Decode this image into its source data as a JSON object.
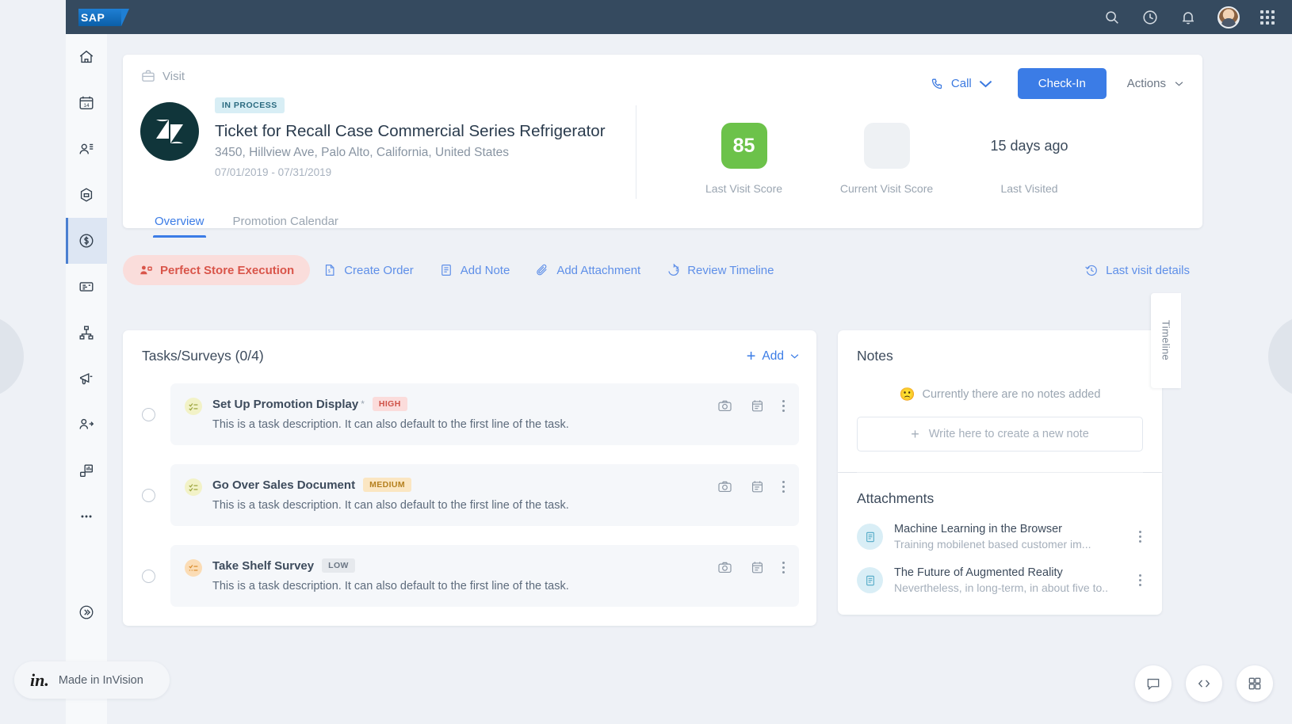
{
  "topbar": {
    "logo_text": "SAP",
    "icons": [
      "search-icon",
      "history-icon",
      "bell-icon",
      "avatar",
      "app-grid-icon"
    ]
  },
  "sidebar": {
    "items": [
      {
        "name": "home",
        "icon": "home-icon",
        "active": false
      },
      {
        "name": "calendar",
        "icon": "calendar-14-icon",
        "active": false
      },
      {
        "name": "contacts",
        "icon": "person-list-icon",
        "active": false
      },
      {
        "name": "products",
        "icon": "hexagon-icon",
        "active": false
      },
      {
        "name": "sales",
        "icon": "dollar-coin-icon",
        "active": true
      },
      {
        "name": "orders",
        "icon": "list-card-icon",
        "active": false
      },
      {
        "name": "hierarchy",
        "icon": "org-tree-icon",
        "active": false
      },
      {
        "name": "campaigns",
        "icon": "megaphone-icon",
        "active": false
      },
      {
        "name": "leads",
        "icon": "person-add-icon",
        "active": false
      },
      {
        "name": "analytics",
        "icon": "chart-board-icon",
        "active": false
      },
      {
        "name": "more",
        "icon": "more-dots-icon",
        "active": false
      },
      {
        "name": "expand",
        "icon": "chevron-double-right-icon",
        "active": false
      }
    ]
  },
  "header": {
    "object_type": "Visit",
    "status": "IN PROCESS",
    "title": "Ticket for Recall Case Commercial Series Refrigerator",
    "address": "3450, Hillview Ave, Palo Alto, California, United States",
    "dates": "07/01/2019 - 07/31/2019",
    "call_label": "Call",
    "checkin_label": "Check-In",
    "actions_label": "Actions",
    "scores": [
      {
        "value": "85",
        "label": "Last Visit Score",
        "style": "green"
      },
      {
        "value": "",
        "label": "Current Visit Score",
        "style": "empty"
      },
      {
        "value": "15 days ago",
        "label": "Last Visited",
        "style": "plain"
      }
    ],
    "tabs": [
      {
        "label": "Overview",
        "active": true
      },
      {
        "label": "Promotion Calendar",
        "active": false
      }
    ]
  },
  "actionbar": {
    "items": [
      {
        "label": "Perfect Store Execution",
        "icon": "person-badge-icon",
        "highlight": true
      },
      {
        "label": "Create Order",
        "icon": "order-doc-icon",
        "highlight": false
      },
      {
        "label": "Add Note",
        "icon": "note-icon",
        "highlight": false
      },
      {
        "label": "Add Attachment",
        "icon": "paperclip-icon",
        "highlight": false
      },
      {
        "label": "Review Timeline",
        "icon": "timeline-icon",
        "highlight": false
      }
    ],
    "last_visit_label": "Last visit details",
    "last_visit_icon": "clock-back-icon"
  },
  "tasks": {
    "title": "Tasks/Surveys (0/4)",
    "add_label": "Add",
    "items": [
      {
        "name": "Set Up Promotion Display",
        "required": "*",
        "priority": "HIGH",
        "priority_style": "high",
        "icon_style": "yellow",
        "description": "This is a task description. It can also default to the first line of the task."
      },
      {
        "name": "Go Over Sales Document",
        "required": "",
        "priority": "MEDIUM",
        "priority_style": "medium",
        "icon_style": "yellow",
        "description": "This is a task description. It can also default to the first line of the task."
      },
      {
        "name": "Take Shelf Survey",
        "required": "",
        "priority": "LOW",
        "priority_style": "low",
        "icon_style": "orange",
        "description": "This is a task description. It can also default to the first line of the task."
      }
    ],
    "row_icons": [
      "camera-icon",
      "calendar-task-icon",
      "more-vertical-icon"
    ]
  },
  "notes": {
    "title": "Notes",
    "empty_emoji": "🙁",
    "empty_text": "Currently there are no notes added",
    "input_placeholder": "Write here to create a new note"
  },
  "attachments": {
    "title": "Attachments",
    "items": [
      {
        "name": "Machine Learning in the Browser",
        "subtitle": "Training mobilenet based customer im..."
      },
      {
        "name": "The Future of Augmented Reality",
        "subtitle": "Nevertheless, in long-term, in about five to.."
      }
    ]
  },
  "timeline_tab": {
    "label": "Timeline"
  },
  "footer": {
    "invision_logo": "in.",
    "invision_text": "Made in InVision",
    "buttons": [
      "comment-icon",
      "code-icon",
      "grid-icon"
    ]
  },
  "colors": {
    "topbar": "#354a5f",
    "accent_blue": "#3b7ce6",
    "score_green": "#6cc24a",
    "highlight_red": "#d9554a",
    "page_bg": "#eef1f6"
  }
}
